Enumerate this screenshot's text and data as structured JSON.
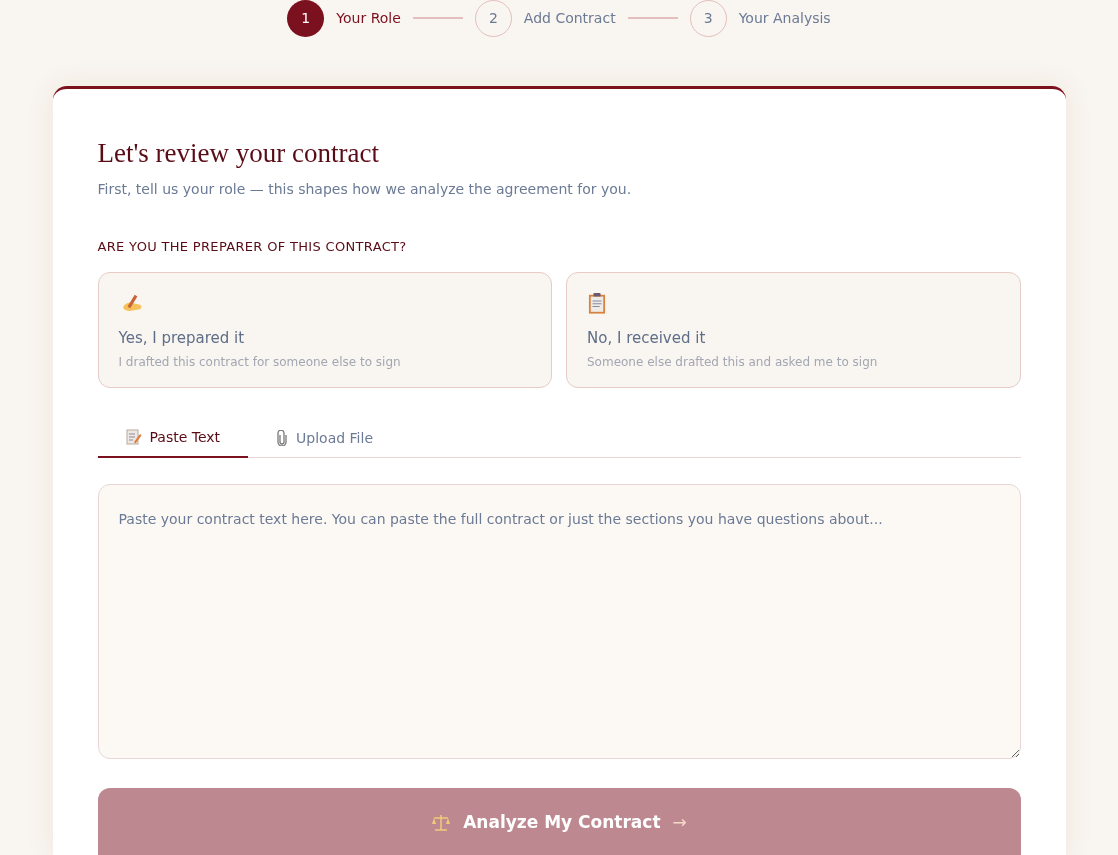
{
  "steps": [
    {
      "number": "1",
      "label": "Your Role",
      "selected": true
    },
    {
      "number": "2",
      "label": "Add Contract",
      "selected": false
    },
    {
      "number": "3",
      "label": "Your Analysis",
      "selected": false
    }
  ],
  "card": {
    "title": "Let's review your contract",
    "subtitle": "First, tell us your role — this shapes how we analyze the agreement for you.",
    "question": "ARE YOU THE PREPARER OF THIS CONTRACT?",
    "roles": [
      {
        "kind": "writing",
        "title": "Yes, I prepared it",
        "description": "I drafted this contract for someone else to sign",
        "selected": false
      },
      {
        "kind": "clipboard",
        "title": "No, I received it",
        "description": "Someone else drafted this and asked me to sign",
        "selected": false
      }
    ],
    "tabs": [
      {
        "kind": "memo",
        "label": "Paste Text",
        "selected": true
      },
      {
        "kind": "paperclip",
        "label": "Upload File",
        "selected": false
      }
    ],
    "textarea": {
      "placeholder": "Paste your contract text here. You can paste the full contract or just the sections you have questions about..."
    },
    "submit": {
      "label": "Analyze My Contract",
      "arrow": "→",
      "disabled": true
    }
  }
}
